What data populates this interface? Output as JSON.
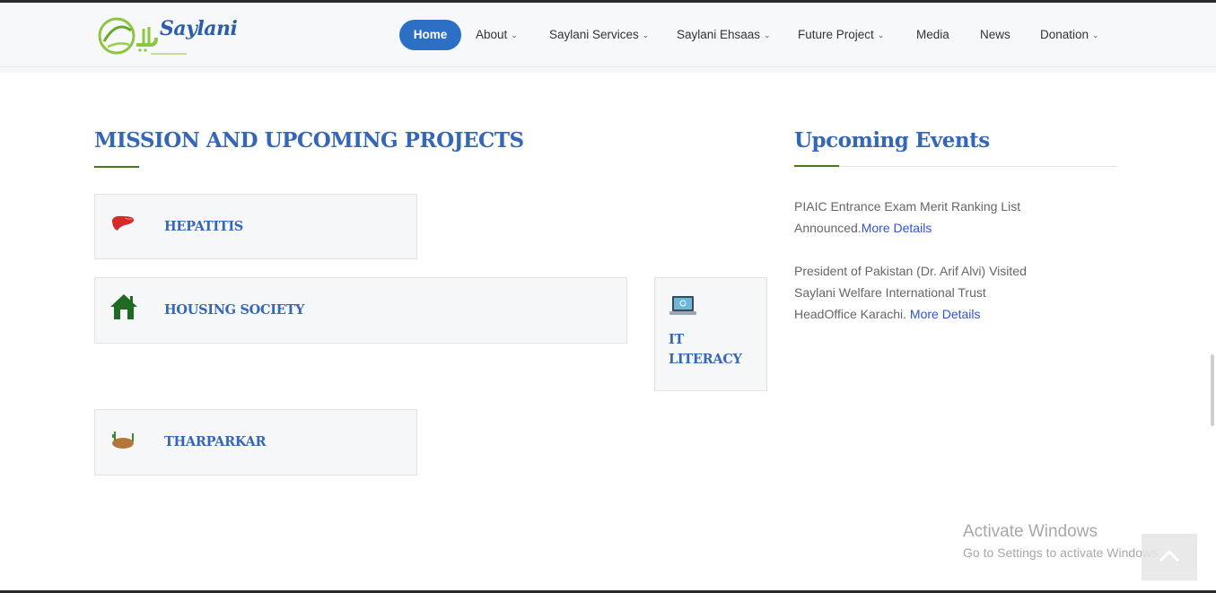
{
  "nav": {
    "items": [
      {
        "label": "Home",
        "active": true,
        "dropdown": false
      },
      {
        "label": "About",
        "active": false,
        "dropdown": true
      },
      {
        "label": "Saylani Services",
        "active": false,
        "dropdown": true
      },
      {
        "label": "Saylani Ehsaas",
        "active": false,
        "dropdown": true
      },
      {
        "label": "Future Project",
        "active": false,
        "dropdown": true
      },
      {
        "label": "Media",
        "active": false,
        "dropdown": false
      },
      {
        "label": "News",
        "active": false,
        "dropdown": false
      },
      {
        "label": "Donation",
        "active": false,
        "dropdown": true
      }
    ],
    "accent_color": "#2d6fc5"
  },
  "logo": {
    "text": "Saylani"
  },
  "mission": {
    "title": "MISSION AND UPCOMING PROJECTS",
    "projects": [
      {
        "label": "HEPATITIS",
        "icon": "liver-icon"
      },
      {
        "label": "HOUSING SOCIETY",
        "icon": "house-icon"
      },
      {
        "label": "IT LITERACY",
        "icon": "laptop-icon"
      },
      {
        "label": "THARPARKAR",
        "icon": "desert-icon"
      }
    ]
  },
  "events": {
    "title": "Upcoming Events",
    "items": [
      {
        "text": "PIAIC Entrance Exam Merit Ranking List Announced.",
        "link": "More Details"
      },
      {
        "text": "President of Pakistan (Dr. Arif Alvi) Visited Saylani Welfare International Trust HeadOffice Karachi. ",
        "link": "More Details"
      }
    ]
  },
  "watermark": {
    "line1": "Activate Windows",
    "line2": "Go to Settings to activate Windows."
  },
  "colors": {
    "heading": "#3567b8",
    "green_rule": "#4a7a18",
    "link": "#2f54d8"
  }
}
